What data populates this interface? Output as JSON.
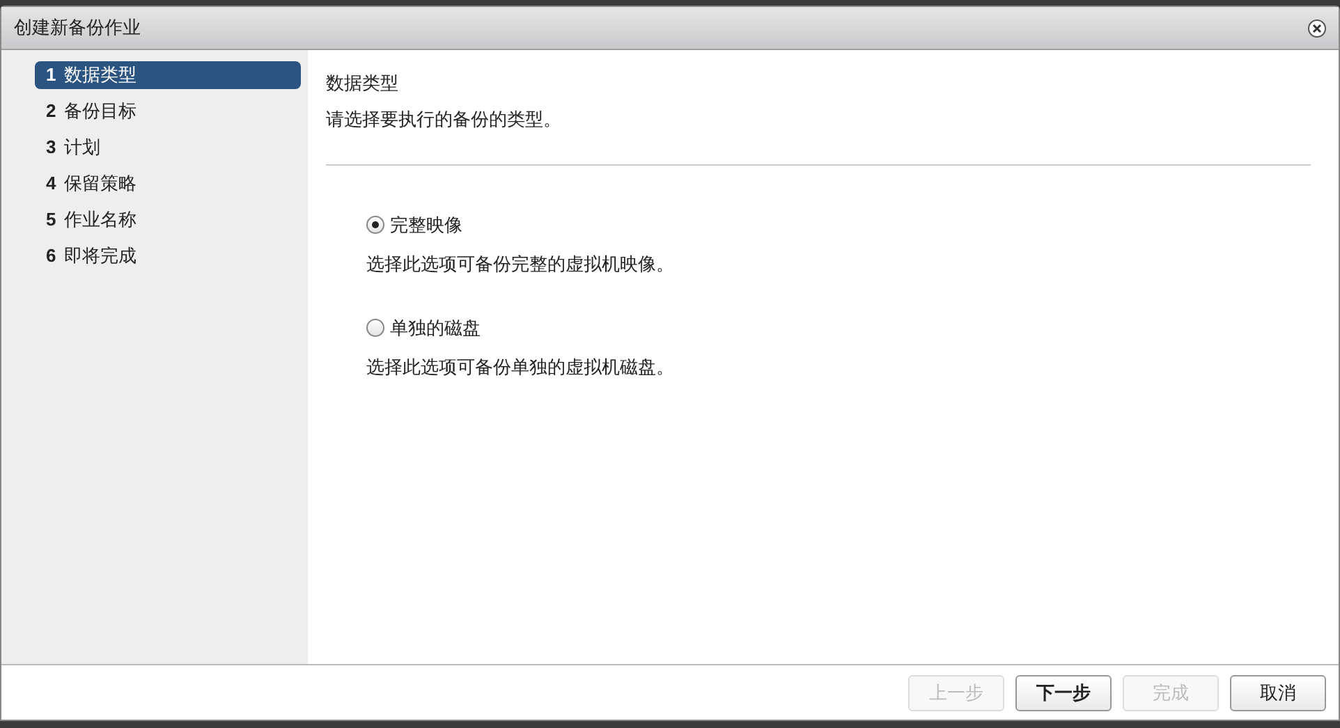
{
  "window": {
    "title": "创建新备份作业"
  },
  "steps": [
    {
      "number": "1",
      "label": "数据类型",
      "selected": true
    },
    {
      "number": "2",
      "label": "备份目标",
      "selected": false
    },
    {
      "number": "3",
      "label": "计划",
      "selected": false
    },
    {
      "number": "4",
      "label": "保留策略",
      "selected": false
    },
    {
      "number": "5",
      "label": "作业名称",
      "selected": false
    },
    {
      "number": "6",
      "label": "即将完成",
      "selected": false
    }
  ],
  "heading": "数据类型",
  "subtitle": "请选择要执行的备份的类型。",
  "options": [
    {
      "label": "完整映像",
      "description": "选择此选项可备份完整的虚拟机映像。",
      "selected": true
    },
    {
      "label": "单独的磁盘",
      "description": "选择此选项可备份单独的虚拟机磁盘。",
      "selected": false
    }
  ],
  "buttons": [
    {
      "label": "上一步",
      "disabled": true,
      "primary": false
    },
    {
      "label": "下一步",
      "disabled": false,
      "primary": true
    },
    {
      "label": "完成",
      "disabled": true,
      "primary": false
    },
    {
      "label": "取消",
      "disabled": false,
      "primary": false
    }
  ]
}
